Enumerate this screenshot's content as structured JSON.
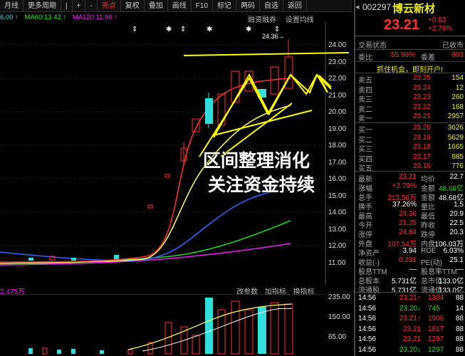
{
  "toolbar": {
    "items": [
      "月线",
      "更多周期",
      "|",
      "+",
      "-",
      "亮点",
      "复权",
      "叠加",
      "画线",
      "F10",
      "标记",
      "两码",
      "自选",
      "返回"
    ]
  },
  "ma": {
    "ma_prefix": "6.00 ↑",
    "ma60": "MA60:13.42 ↑",
    "ma120": "MA120:11.96 ↑"
  },
  "ctrl_top": [
    "融资融券",
    "设置均线"
  ],
  "price_axis": [
    "24.00",
    "23.00",
    "22.00",
    "21.00",
    "20.00",
    "19.00",
    "18.00",
    "17.00",
    "16.00",
    "15.00",
    "14.00",
    "13.00",
    "12.00",
    "11.00"
  ],
  "high_label": "24.36→",
  "annotation": {
    "line1": "区间整理消化",
    "line2": "关注资金持续"
  },
  "volume": {
    "label": "2.475万",
    "ctrl": [
      "改参数",
      "加指标",
      "换指标"
    ],
    "axis": [
      "235.00",
      "150.00",
      "65.00"
    ]
  },
  "stock": {
    "code": "002297",
    "name": "博云新材",
    "price": "23.21",
    "change": "+0.63",
    "pct": "+2.79%"
  },
  "status": {
    "label": "交易状态",
    "value": "已收市"
  },
  "ratio": {
    "l1": "委比",
    "v1": "55.98%",
    "l2": "委差",
    "v2": "903"
  },
  "promo": "抓住机会，即刻开户!",
  "asks": [
    {
      "label": "卖五",
      "price": "23.25",
      "vol": "154"
    },
    {
      "label": "卖四",
      "price": "23.24",
      "vol": "12"
    },
    {
      "label": "卖三",
      "price": "23.23",
      "vol": "260"
    },
    {
      "label": "卖二",
      "price": "23.22",
      "vol": "168"
    },
    {
      "label": "卖一",
      "price": "23.21",
      "vol": "2957"
    }
  ],
  "bids": [
    {
      "label": "买一",
      "price": "23.20",
      "vol": "3626"
    },
    {
      "label": "买二",
      "price": "23.19",
      "vol": "5629"
    },
    {
      "label": "买三",
      "price": "23.18",
      "vol": "1665"
    },
    {
      "label": "买四",
      "price": "23.17",
      "vol": "885"
    },
    {
      "label": "买五",
      "price": "23.16",
      "vol": "776"
    }
  ],
  "stats": [
    {
      "l": "最新",
      "v": "23.21",
      "l2": "均价",
      "v2": "22.7"
    },
    {
      "l": "涨幅",
      "v": "+2.79%",
      "l2": "金额",
      "v2": "48.68亿"
    },
    {
      "l": "总手",
      "v": "213.56万",
      "l2": "金额",
      "v2": "48.68亿"
    },
    {
      "l": "换手",
      "v": "37.26%",
      "l2": "量比",
      "v2": "1.5"
    },
    {
      "l": "最高",
      "v": "24.36",
      "l2": "最低",
      "v2": "20.9"
    },
    {
      "l": "今开",
      "v": "21.25",
      "l2": "昨收",
      "v2": "22.5"
    },
    {
      "l": "涨停",
      "v": "24.84",
      "l2": "跌停",
      "v2": "20.3"
    },
    {
      "l": "外盘",
      "v": "107.54万",
      "l2": "内盘",
      "v2": "106.03万"
    },
    {
      "l": "净资产",
      "v": "3.94",
      "l2": "ROE",
      "v2": "6.03%"
    },
    {
      "l": "收益(-)",
      "v": "0.231",
      "l2": "PE(动)",
      "v2": "25.1"
    },
    {
      "l": "股息TTM",
      "v": "—",
      "l2": "股息率TTM",
      "v2": "—"
    },
    {
      "l": "总股本",
      "v": "5.731亿",
      "l2": "总市值",
      "v2": "133.0亿"
    },
    {
      "l": "流通股",
      "v": "5.731亿",
      "l2": "流通值",
      "v2": "133.0亿"
    }
  ],
  "ticks": [
    {
      "t": "14:56",
      "p": "23.21",
      "arrow": "↑",
      "v": "1304",
      "n": "88"
    },
    {
      "t": "14:56",
      "p": "23.20",
      "arrow": "↓",
      "v": "745",
      "n": "14"
    },
    {
      "t": "14:56",
      "p": "23.21",
      "arrow": "↑",
      "v": "1906",
      "n": "88"
    },
    {
      "t": "14:56",
      "p": "23.21",
      "arrow": "",
      "v": "1817",
      "n": "88"
    },
    {
      "t": "14:56",
      "p": "23.21",
      "arrow": "",
      "v": "1297",
      "n": "88"
    },
    {
      "t": "14:56",
      "p": "23.20",
      "arrow": "↓",
      "v": "1297",
      "n": "88"
    }
  ],
  "colors": {
    "up": "#ff3333",
    "down": "#22dd22",
    "yellow": "#eeee22",
    "cyan": "#33dddd",
    "magenta": "#ee22ee"
  }
}
